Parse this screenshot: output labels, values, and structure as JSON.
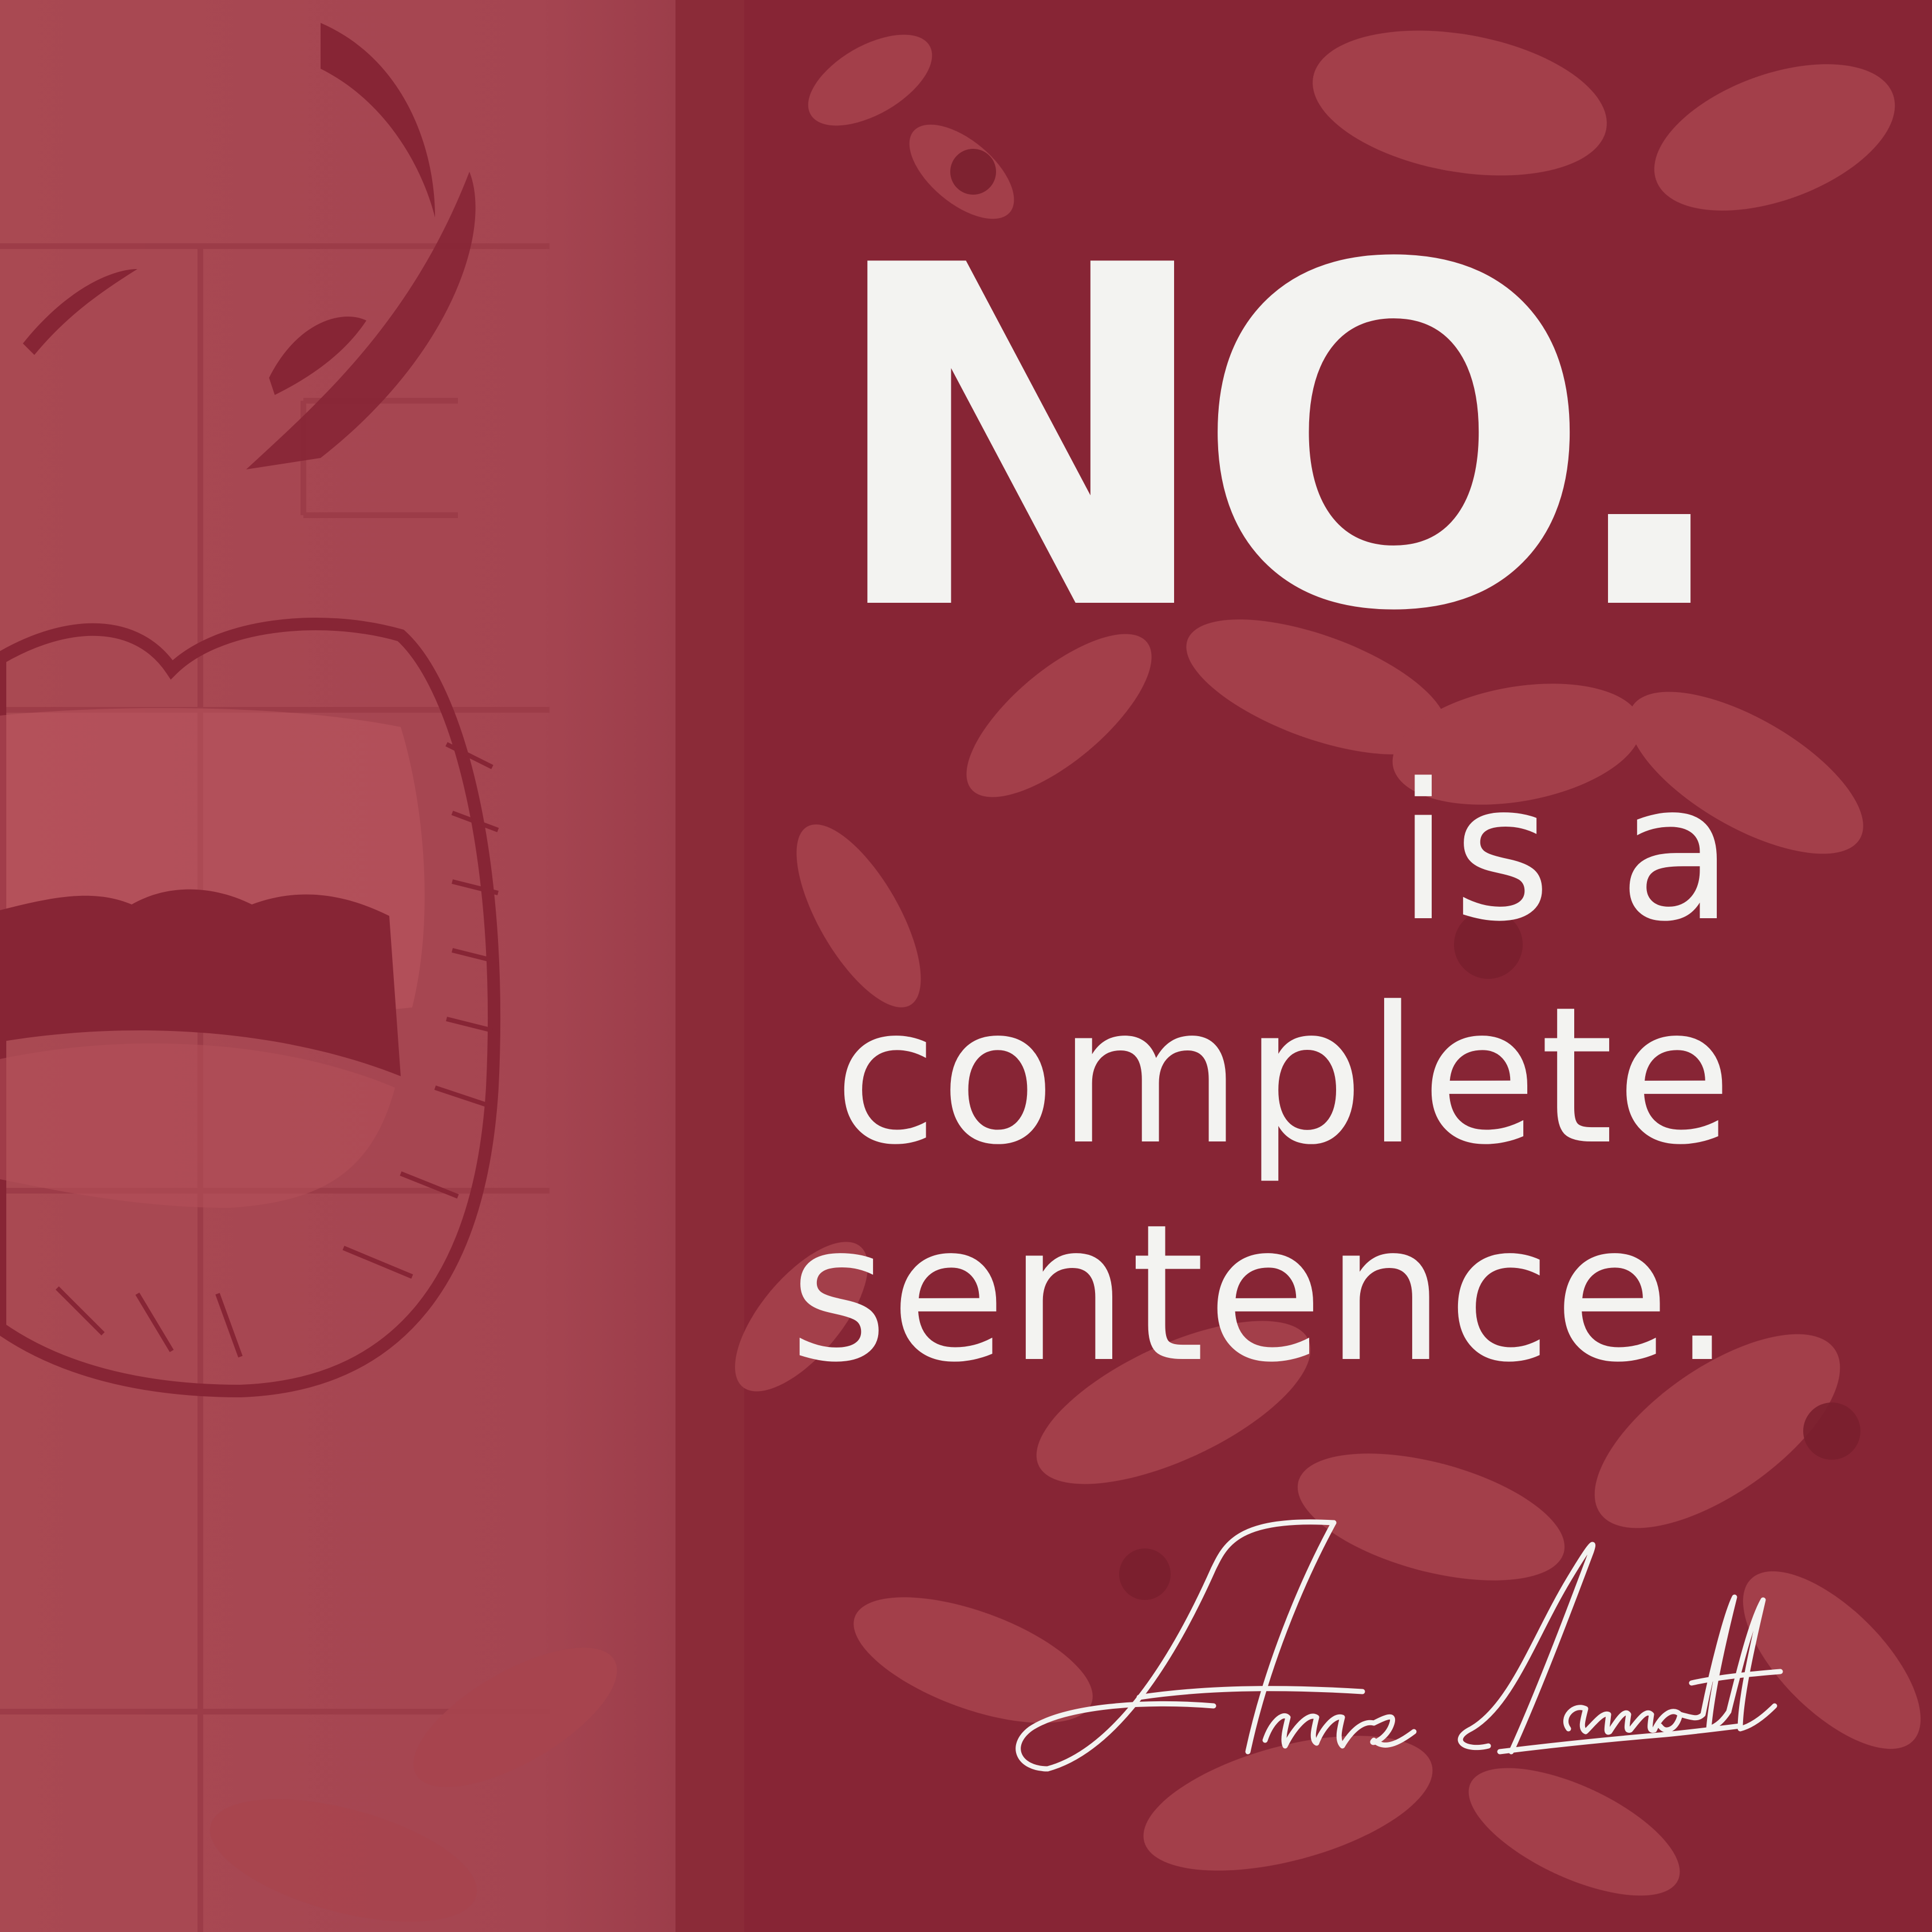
{
  "quote": {
    "headline": "NO.",
    "line_1": "is a",
    "line_2": "complete",
    "line_3": "sentence."
  },
  "author": {
    "signature": "Anne Lamott"
  },
  "colors": {
    "background": "#882636",
    "wall": "#a94952",
    "text": "#f3f3f1"
  }
}
